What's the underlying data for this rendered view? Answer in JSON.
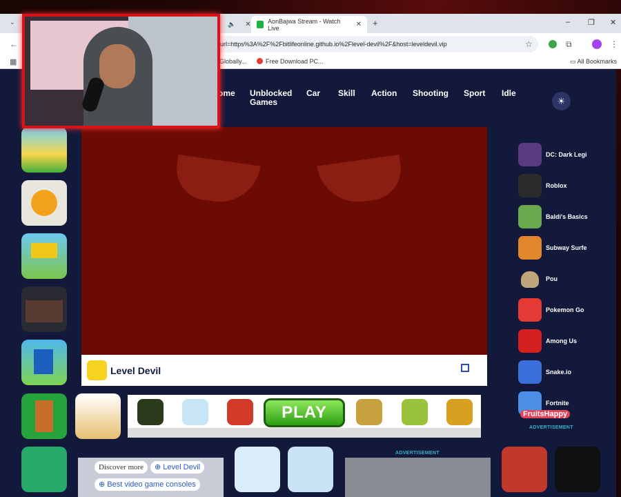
{
  "browser": {
    "tabs": [
      {
        "label": "AonBajwa Stream - Watch Live",
        "favicon_color": "#1fb141"
      }
    ],
    "new_tab": "+",
    "url": "_url=https%3A%2F%2Fbitlifeonline.github.io%2Flevel-devil%2F&host=leveldevil.vip",
    "bookmarks": [
      {
        "label": "Globally..."
      },
      {
        "label": "Free Download PC..."
      }
    ],
    "all_bookmarks": "All Bookmarks",
    "window_controls": {
      "minimize": "–",
      "restore": "❐",
      "close": "✕"
    }
  },
  "site": {
    "nav": [
      {
        "label": "ome"
      },
      {
        "label": "Unblocked Games"
      },
      {
        "label": "Car"
      },
      {
        "label": "Skill"
      },
      {
        "label": "Action"
      },
      {
        "label": "Shooting"
      },
      {
        "label": "Sport"
      },
      {
        "label": "Idle"
      }
    ],
    "theme_icon": "☀",
    "game": {
      "title": "Level Devil",
      "bg_color": "#6c0b04"
    },
    "right_sidebar": [
      {
        "label": "DC: Dark Legi",
        "color": "#5a3a80"
      },
      {
        "label": "Roblox",
        "color": "#2b2b2b"
      },
      {
        "label": "Baldi's Basics",
        "color": "#6aa84f"
      },
      {
        "label": "Subway Surfe",
        "color": "#e2862c"
      },
      {
        "label": "Pou",
        "color": "#13193a"
      },
      {
        "label": "Pokemon Go",
        "color": "#e53935"
      },
      {
        "label": "Among Us",
        "color": "#d61f1f"
      },
      {
        "label": "Snake.io",
        "color": "#3b6ed8"
      },
      {
        "label": "Fortnite",
        "color": "#4b8ee8"
      }
    ],
    "fruits_label": "FruitsHappy",
    "advertisement": "ADVERTISEMENT",
    "ad_play": "PLAY",
    "discover_more": "Discover more",
    "discover_link": "Level Devil",
    "discover_link2": "Best video game consoles"
  }
}
